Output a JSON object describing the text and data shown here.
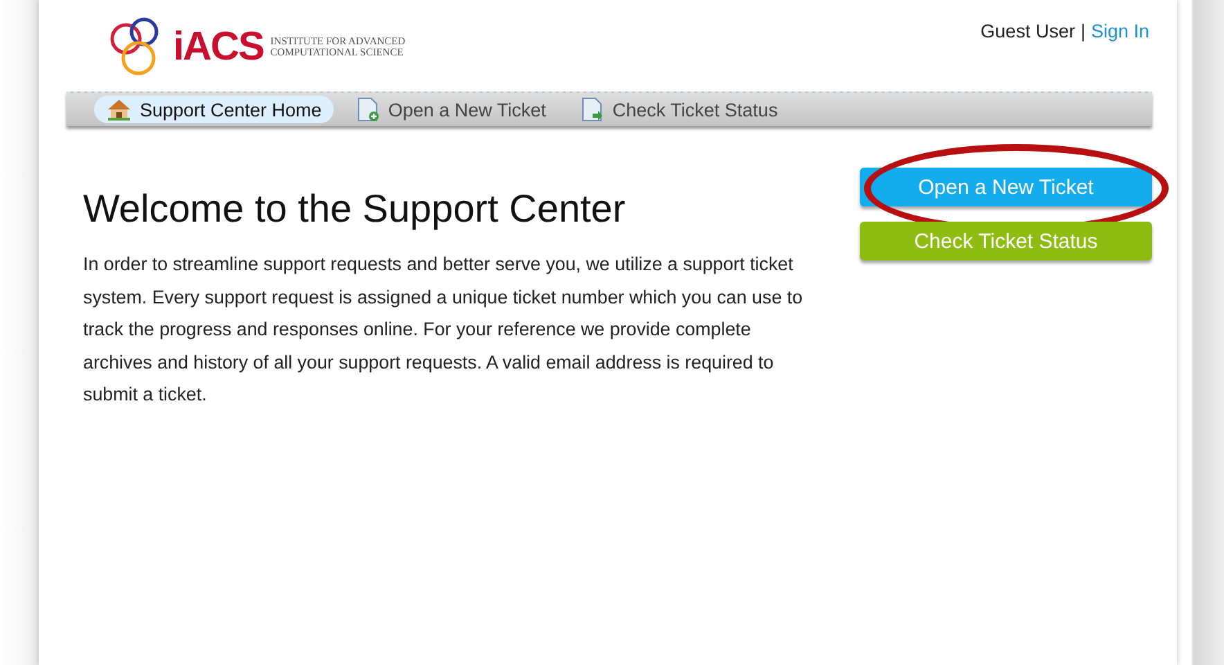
{
  "logo": {
    "mark": "iACS",
    "tagline": [
      "INSTITUTE FOR ADVANCED",
      "COMPUTATIONAL SCIENCE"
    ]
  },
  "user_links": {
    "user": "Guest User",
    "separator": "|",
    "sign_in": "Sign In"
  },
  "nav": [
    {
      "label": "Support Center Home",
      "kind": "home",
      "selected": true
    },
    {
      "label": "Open a New Ticket",
      "kind": "new",
      "selected": false
    },
    {
      "label": "Check Ticket Status",
      "kind": "status",
      "selected": false
    }
  ],
  "heading": "Welcome to the Support Center",
  "intro": "In order to streamline support requests and better serve you, we utilize a support ticket system. Every support request is assigned a unique ticket number which you can use to track the progress and responses online. For your reference we provide complete archives and history of all your support requests. A valid email address is required to submit a ticket.",
  "actions": [
    {
      "label": "Open a New Ticket",
      "kind": "primary",
      "circled": true
    },
    {
      "label": "Check Ticket Status",
      "kind": "secondary",
      "circled": false
    }
  ]
}
